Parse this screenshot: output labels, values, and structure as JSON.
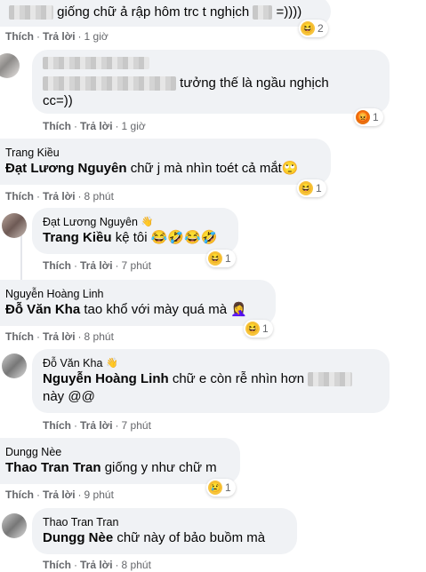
{
  "action_like": "Thích",
  "action_reply": "Trả lời",
  "sep": "·",
  "comments": [
    {
      "author": "",
      "mention": "",
      "text": "giống chữ ả rập hôm trc t nghịch",
      "text_tail": "=))))",
      "time": "1 giờ",
      "reaction_count": "2",
      "reaction": "haha"
    },
    {
      "author": "",
      "mention": "",
      "text": "tưởng thế là ngầu nghịch",
      "text2": "cc=))",
      "time": "1 giờ",
      "reaction_count": "1",
      "reaction": "angry"
    },
    {
      "author": "Trang Kiều",
      "mention": "Đạt Lương Nguyên",
      "text": "chữ j mà nhìn toét cả mắt",
      "emoji": "🙄",
      "time": "8 phút",
      "reaction_count": "1",
      "reaction": "haha"
    },
    {
      "author": "Đạt Lương Nguyên",
      "mention": "Trang Kiều",
      "text": "kệ tôi",
      "emoji": "😂🤣😂🤣",
      "time": "7 phút",
      "reaction_count": "1",
      "reaction": "haha"
    },
    {
      "author": "Nguyễn Hoàng Linh",
      "mention": "Đỗ Văn Kha",
      "text": "tao khổ với mày quá mà",
      "emoji": "🤦‍♀️",
      "time": "8 phút",
      "reaction_count": "1",
      "reaction": "haha"
    },
    {
      "author": "Đỗ Văn Kha",
      "mention": "Nguyễn Hoàng Linh",
      "text": "chữ e còn rễ nhìn hơn",
      "text2": "này @@",
      "time": "7 phút",
      "reaction_count": "",
      "reaction": ""
    },
    {
      "author": "Dungg Nèe",
      "mention": "Thao Tran Tran",
      "text": "giống y như chữ m",
      "time": "9 phút",
      "reaction_count": "1",
      "reaction": "sad"
    },
    {
      "author": "Thao Tran Tran",
      "mention": "Dungg Nèe",
      "text": "chữ này of bảo buồm mà",
      "time": "8 phút",
      "reaction_count": "",
      "reaction": ""
    }
  ],
  "icons": {
    "haha": "😆",
    "angry": "😡",
    "sad": "😢",
    "hand": "👋"
  }
}
